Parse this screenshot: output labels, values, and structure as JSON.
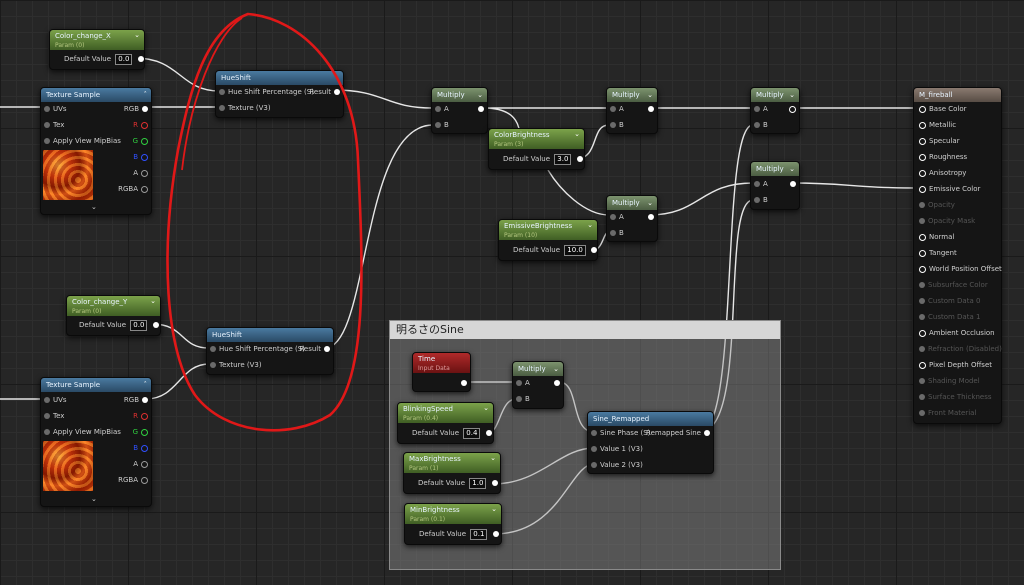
{
  "comment": {
    "title": "明るさのSine"
  },
  "color_change_x": {
    "title": "Color_change_X",
    "subtitle": "Param (0)",
    "default_label": "Default Value",
    "value": "0.0"
  },
  "color_change_y": {
    "title": "Color_change_Y",
    "subtitle": "Param (0)",
    "default_label": "Default Value",
    "value": "0.0"
  },
  "texture_sample": {
    "title": "Texture Sample",
    "pins_in": [
      "UVs",
      "Tex",
      "Apply View MipBias"
    ],
    "pins_out": [
      "RGB",
      "R",
      "G",
      "B",
      "A",
      "RGBA"
    ]
  },
  "hueshift": {
    "title": "HueShift",
    "pin_in_1": "Hue Shift Percentage (S)",
    "pin_in_2": "Texture (V3)",
    "pin_out": "Result"
  },
  "multiply": {
    "title": "Multiply",
    "pin_a": "A",
    "pin_b": "B"
  },
  "colorbrightness": {
    "title": "ColorBrightness",
    "subtitle": "Param (3)",
    "default_label": "Default Value",
    "value": "3.0"
  },
  "emissivebrightness": {
    "title": "EmissiveBrightness",
    "subtitle": "Param (10)",
    "default_label": "Default Value",
    "value": "10.0"
  },
  "time": {
    "title": "Time",
    "subtitle": "Input Data"
  },
  "blinkingspeed": {
    "title": "BlinkingSpeed",
    "subtitle": "Param (0.4)",
    "default_label": "Default Value",
    "value": "0.4"
  },
  "maxbrightness": {
    "title": "MaxBrightness",
    "subtitle": "Param (1)",
    "default_label": "Default Value",
    "value": "1.0"
  },
  "minbrightness": {
    "title": "MinBrightness",
    "subtitle": "Param (0.1)",
    "default_label": "Default Value",
    "value": "0.1"
  },
  "sine_remapped": {
    "title": "Sine_Remapped",
    "pin_in_1": "Sine Phase (S)",
    "pin_in_2": "Value 1 (V3)",
    "pin_in_3": "Value 2 (V3)",
    "pin_out": "Remapped Sine"
  },
  "material": {
    "title": "M_fireball",
    "pins": [
      {
        "label": "Base Color",
        "active": true
      },
      {
        "label": "Metallic",
        "active": true
      },
      {
        "label": "Specular",
        "active": true
      },
      {
        "label": "Roughness",
        "active": true
      },
      {
        "label": "Anisotropy",
        "active": true
      },
      {
        "label": "Emissive Color",
        "active": true
      },
      {
        "label": "Opacity",
        "active": false
      },
      {
        "label": "Opacity Mask",
        "active": false
      },
      {
        "label": "Normal",
        "active": true
      },
      {
        "label": "Tangent",
        "active": true
      },
      {
        "label": "World Position Offset",
        "active": true
      },
      {
        "label": "Subsurface Color",
        "active": false
      },
      {
        "label": "Custom Data 0",
        "active": false
      },
      {
        "label": "Custom Data 1",
        "active": false
      },
      {
        "label": "Ambient Occlusion",
        "active": true
      },
      {
        "label": "Refraction (Disabled)",
        "active": false
      },
      {
        "label": "Pixel Depth Offset",
        "active": true
      },
      {
        "label": "Shading Model",
        "active": false
      },
      {
        "label": "Surface Thickness",
        "active": false
      },
      {
        "label": "Front Material",
        "active": false
      }
    ]
  },
  "colors": {
    "annotation": "#e01818",
    "wire": "#e6e6e6",
    "param_header": "#6b9140",
    "texture_header": "#3d6a8e"
  }
}
